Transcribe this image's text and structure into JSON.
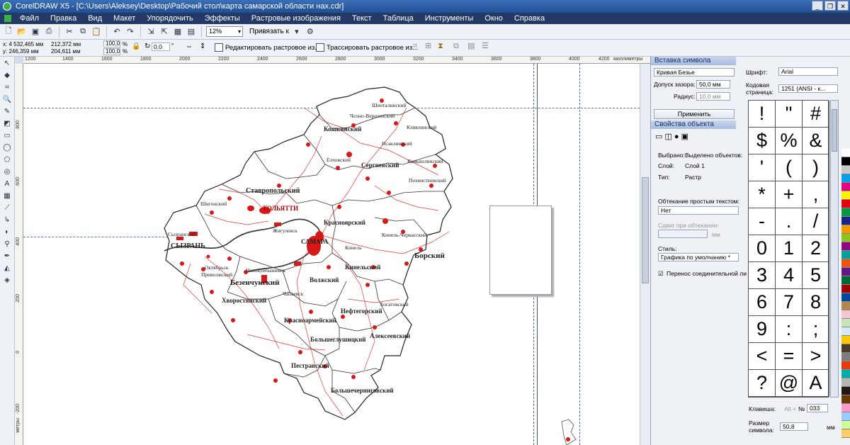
{
  "window": {
    "title": "CorelDRAW X5 - [C:\\Users\\Aleksey\\Desktop\\Рабочий стол\\карта самарской области нах.cdr]",
    "buttons": [
      "_",
      "❐",
      "✕"
    ]
  },
  "menu": [
    "Файл",
    "Правка",
    "Вид",
    "Макет",
    "Упорядочить",
    "Эффекты",
    "Растровые изображения",
    "Текст",
    "Таблица",
    "Инструменты",
    "Окно",
    "Справка"
  ],
  "toolbar": {
    "zoom": "12%",
    "snap": "Привязать к"
  },
  "propbar": {
    "x": "x: 4 532,465 мм",
    "y": "y: 246,359 мм",
    "width": "212,372 мм",
    "height": "204,611 мм",
    "scale_x": "100,0",
    "scale_y": "100,0",
    "pct1": "%",
    "pct2": "%",
    "angle": "0,0",
    "angle_unit": "°",
    "edit_bitmap": "Редактировать растровое из...",
    "trace_bitmap": "Трассировать растровое из..."
  },
  "ruler": {
    "top_ticks": [
      "1200",
      "1400",
      "1600",
      "1800",
      "2000",
      "2200",
      "2400",
      "2600",
      "2800",
      "3000",
      "3200",
      "3400",
      "3600",
      "3800",
      "4000",
      "4200"
    ],
    "unit": "миллиметры",
    "left_ticks": [
      "800",
      "600",
      "400",
      "200",
      "0",
      "-200",
      "-400"
    ],
    "left_unit": "метры"
  },
  "map": {
    "labels": [
      "Шенталинский",
      "Клявлинский",
      "Челно-Вершинский",
      "Кошкинский",
      "Елховский",
      "Исаклинский",
      "Сергиевский",
      "Камышлинский",
      "Похвистневский",
      "Ставропольский",
      "ТОЛЬЯТТИ",
      "Шигонский",
      "Красноярский",
      "Кинель-Черкасский",
      "Сызранский",
      "СЫЗРАНЬ",
      "Жигулевск",
      "САМАРА",
      "Кинель",
      "Борский",
      "Кинельский",
      "Октябрьск",
      "Безенчукский",
      "Волжский",
      "Богатовский",
      "Хворостянский",
      "Нефтегорский",
      "Новокуйбышевск",
      "Красноармейский",
      "Алексеевский",
      "Большеглушицкий",
      "Пестравский",
      "Большечерниговский",
      "Приволжский",
      "Чапаевск"
    ]
  },
  "insert_symbol": {
    "header": "Вставка символа",
    "mode": "Кривая Безье",
    "tolerance_label": "Допуск зазора:",
    "tolerance_value": "50,0 мм",
    "radius_label": "Радиус:",
    "radius_value": "10,0 мм",
    "apply": "Применить",
    "font_label": "Шрифт:",
    "font_value": "Arial",
    "codepage_label": "Кодовая страница:",
    "codepage_value": "1251  (ANSI - к...",
    "glyphs": [
      "!",
      "\"",
      "#",
      "$",
      "%",
      "&",
      "'",
      "(",
      ")",
      "*",
      "+",
      ",",
      "-",
      ".",
      "/",
      "0",
      "1",
      "2",
      "3",
      "4",
      "5",
      "6",
      "7",
      "8",
      "9",
      ":",
      ";",
      "<",
      "=",
      ">",
      "?",
      "@",
      "A"
    ],
    "key_label": "Клавиша:",
    "key_hint": "Alt +",
    "key_no": "№",
    "key_value": "033",
    "size_label": "Размер символа:",
    "size_value": "50,8",
    "size_unit": "мм"
  },
  "object_props": {
    "header": "Свойства объекта",
    "selected_label": "Выбрано:",
    "selected_value": "Выделено объектов:",
    "layer_label": "Слой:",
    "layer_value": "Слой 1",
    "type_label": "Тип:",
    "type_value": "Растр",
    "wrap_label": "Обтекание простым текстом:",
    "wrap_value": "Нет",
    "offset_label": "Сдвиг при обтекании:",
    "offset_unit": "мм",
    "style_label": "Стиль:",
    "style_value": "Графика по умолчанию *",
    "connector_label": "Перенос соединительной ли"
  },
  "palette_colors": [
    "#ffffff",
    "#000000",
    "#c8c8c8",
    "#00a0e9",
    "#e4007f",
    "#fff100",
    "#e60012",
    "#009944",
    "#1d2088",
    "#f39800",
    "#8fc31f",
    "#920783",
    "#00a29a",
    "#ea5514",
    "#601986",
    "#006934",
    "#a40000",
    "#00479d",
    "#b28850",
    "#f7c4d2",
    "#c9e3b9",
    "#d4eaf7",
    "#fcc800",
    "#4b3c2a",
    "#7d7d7d",
    "#e8380d",
    "#00ada9",
    "#b5b5b6",
    "#231815",
    "#6a3906",
    "#ff99cc",
    "#99ccff",
    "#ccff99",
    "#ffcc66"
  ],
  "accent": "#d81818"
}
